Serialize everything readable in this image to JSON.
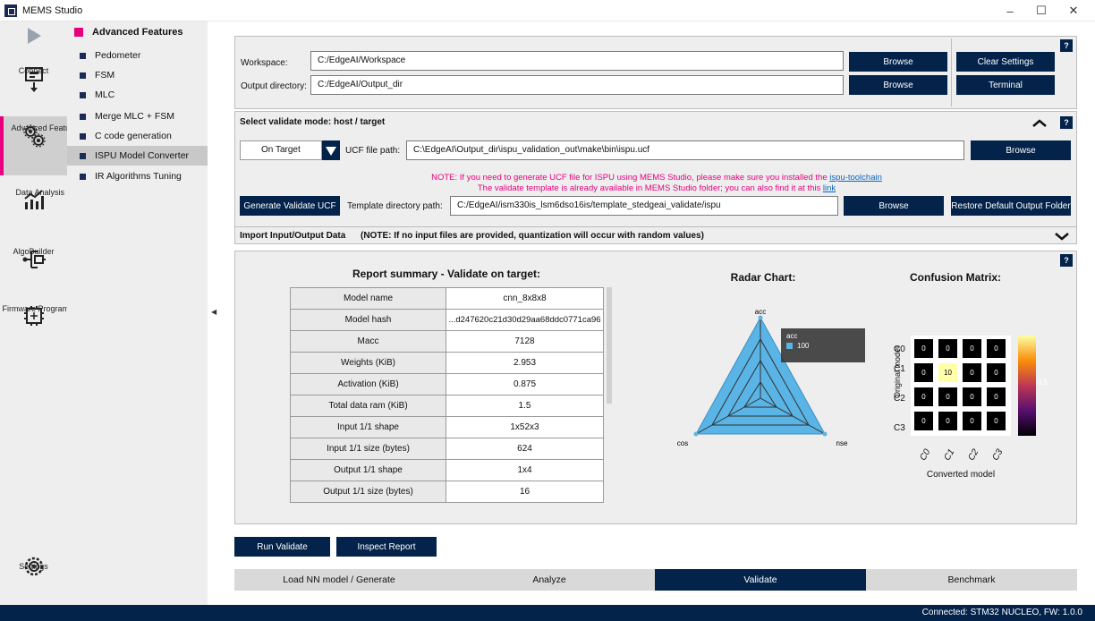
{
  "window": {
    "title": "MEMS Studio",
    "minimize": "–",
    "maximize": "☐",
    "close": "✕"
  },
  "leftbar": {
    "items": [
      {
        "label": "Connect"
      },
      {
        "label": "Advanced Features"
      },
      {
        "label": "Data Analysis"
      },
      {
        "label": "AlgoBuilder"
      },
      {
        "label": "Firmware Programming"
      },
      {
        "label": "Settings"
      }
    ]
  },
  "sidebar": {
    "header": "Advanced Features",
    "items": [
      {
        "label": "Pedometer"
      },
      {
        "label": "FSM"
      },
      {
        "label": "MLC"
      },
      {
        "label": "Merge MLC + FSM"
      },
      {
        "label": "C code generation"
      },
      {
        "label": "ISPU Model Converter"
      },
      {
        "label": "IR Algorithms Tuning"
      }
    ]
  },
  "workspace": {
    "workspace_label": "Workspace:",
    "workspace_value": "C:/EdgeAI/Workspace",
    "output_label": "Output directory:",
    "output_value": "C:/EdgeAI/Output_dir",
    "browse": "Browse",
    "clear_settings": "Clear Settings",
    "terminal": "Terminal",
    "help": "?"
  },
  "validate": {
    "title": "Select validate mode: host / target",
    "mode": "On Target",
    "ucf_label": "UCF file path:",
    "ucf_value": "C:\\EdgeAI\\Output_dir\\ispu_validation_out\\make\\bin\\ispu.ucf",
    "browse": "Browse",
    "note1": "NOTE: If you need to generate UCF file for ISPU using MEMS Studio, please make sure you installed the ",
    "note1_link": "ispu-toolchain",
    "note2": "The validate template is already available in MEMS Studio folder; you can also find it at this ",
    "note2_link": "link",
    "generate": "Generate Validate UCF",
    "template_label": "Template directory path:",
    "template_value": "C:/EdgeAI/ism330is_lsm6dso16is/template_stedgeai_validate/ispu",
    "restore": "Restore Default Output Folder",
    "help": "?"
  },
  "import": {
    "title": "Import Input/Output Data",
    "note": "(NOTE: If no input files are provided, quantization will occur with random values)"
  },
  "report": {
    "title": "Report summary - Validate on target:",
    "rows": [
      {
        "key": "Model name",
        "value": "cnn_8x8x8"
      },
      {
        "key": "Model hash",
        "value": "...d247620c21d30d29aa68ddc0771ca96"
      },
      {
        "key": "Macc",
        "value": "7128"
      },
      {
        "key": "Weights (KiB)",
        "value": "2.953"
      },
      {
        "key": "Activation (KiB)",
        "value": "0.875"
      },
      {
        "key": "Total data ram (KiB)",
        "value": "1.5"
      },
      {
        "key": "Input 1/1 shape",
        "value": "1x52x3"
      },
      {
        "key": "Input 1/1 size (bytes)",
        "value": "624"
      },
      {
        "key": "Output 1/1 shape",
        "value": "1x4"
      },
      {
        "key": "Output 1/1 size (bytes)",
        "value": "16"
      }
    ],
    "help": "?"
  },
  "radar": {
    "title": "Radar Chart:",
    "axes": [
      "acc",
      "cos",
      "nse"
    ],
    "tooltip_label": "acc",
    "tooltip_value": "100",
    "color": "#5ab4e5"
  },
  "confusion": {
    "title": "Confusion Matrix:",
    "ylabel": "Original model",
    "xlabel": "Converted model",
    "rows": [
      "C0",
      "C1",
      "C2",
      "C3"
    ],
    "matrix": [
      [
        "0",
        "0",
        "0",
        "0"
      ],
      [
        "0",
        "10",
        "0",
        "0"
      ],
      [
        "0",
        "0",
        "0",
        "0"
      ],
      [
        "0",
        "0",
        "0",
        "0"
      ]
    ],
    "colorbar_label": "0.5",
    "x_ticks": [
      "C0",
      "C1",
      "C2",
      "C3"
    ]
  },
  "actions": {
    "run": "Run Validate",
    "inspect": "Inspect Report"
  },
  "tabs": [
    {
      "label": "Load NN model / Generate"
    },
    {
      "label": "Analyze"
    },
    {
      "label": "Validate"
    },
    {
      "label": "Benchmark"
    }
  ],
  "status": {
    "text": "Connected:  STM32 NUCLEO, FW: 1.0.0"
  }
}
